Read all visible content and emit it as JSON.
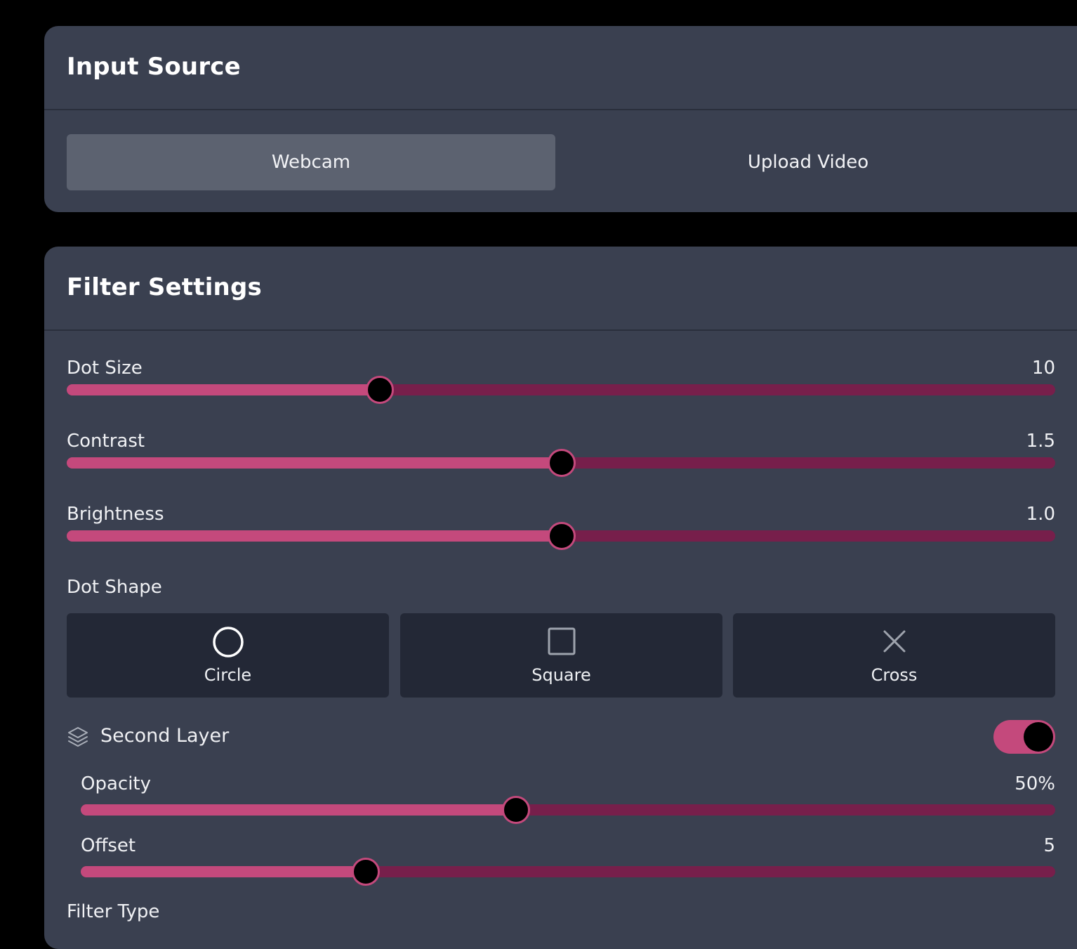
{
  "input_source": {
    "title": "Input Source",
    "options": [
      {
        "label": "Webcam",
        "selected": true
      },
      {
        "label": "Upload Video",
        "selected": false
      }
    ]
  },
  "filter_settings": {
    "title": "Filter Settings",
    "sliders": {
      "dot_size": {
        "label": "Dot Size",
        "value": "10",
        "fill_fraction": 0.316
      },
      "contrast": {
        "label": "Contrast",
        "value": "1.5",
        "fill_fraction": 0.5
      },
      "brightness": {
        "label": "Brightness",
        "value": "1.0",
        "fill_fraction": 0.5
      }
    },
    "dot_shape": {
      "label": "Dot Shape",
      "options": [
        {
          "label": "Circle",
          "icon": "circle-icon"
        },
        {
          "label": "Square",
          "icon": "square-icon"
        },
        {
          "label": "Cross",
          "icon": "cross-icon"
        }
      ]
    },
    "second_layer": {
      "label": "Second Layer",
      "icon": "layers-icon",
      "enabled": true,
      "sliders": {
        "opacity": {
          "label": "Opacity",
          "value": "50%",
          "fill_fraction": 0.446
        },
        "offset": {
          "label": "Offset",
          "value": "5",
          "fill_fraction": 0.292
        }
      }
    },
    "filter_type": {
      "label": "Filter Type"
    }
  },
  "colors": {
    "background": "#000000",
    "panel": "#3a4050",
    "accent": "#c4497c",
    "track": "#771f4b",
    "shape_button": "#232836"
  }
}
